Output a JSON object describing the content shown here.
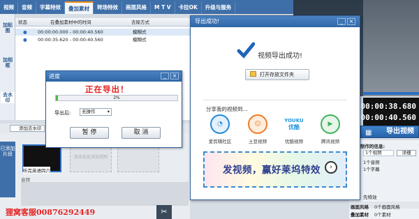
{
  "tabs": [
    "视频",
    "音频",
    "字幕特效",
    "叠加素材",
    "转场特效",
    "画面风格",
    "M T V",
    "卡拉OK",
    "升级与服务"
  ],
  "active_tab": 3,
  "sidebar": {
    "add_sticker": "加贴图",
    "add_frame": "加相框",
    "remove_watermark": "去水印",
    "add_segment": "已添加片段"
  },
  "subtitle_table": {
    "headers": [
      "状态",
      "在叠加素材中的时间",
      "去除方式"
    ],
    "rows": [
      {
        "time": "00:00:00.000 - 00:00:40.560",
        "mode": "模糊式"
      },
      {
        "time": "00:00:35.620 - 00:00:40.560",
        "mode": "模糊式"
      }
    ]
  },
  "progress_dialog": {
    "title": "进度",
    "status_text": "正在导出！",
    "percent": 2,
    "percent_label": "2%",
    "after_export_label": "导出后:",
    "after_export_value": "无操作",
    "pause_label": "暂 停",
    "cancel_label": "取 消"
  },
  "success_dialog": {
    "title": "导出成功!",
    "message": "视频导出成功!",
    "open_folder_label": "打开存放文件夹",
    "share_label": "分享我的视频到...",
    "share_targets": [
      {
        "label": "爱剪辑社区",
        "icon": "aijianji-icon",
        "color": "#1e88d8"
      },
      {
        "label": "土豆视频",
        "icon": "tudou-icon",
        "color": "#f07a23"
      },
      {
        "label": "优酷视频",
        "icon": "youku-icon",
        "color": "#1f95e0"
      },
      {
        "label": "腾讯视频",
        "icon": "tencent-video-icon",
        "color": "#3fb15a"
      }
    ],
    "youku_logo": "YOUKU",
    "youku_logo_sub": "优酷",
    "banner_text": "发视频，赢好莱坞特效"
  },
  "timeline": {
    "add_watermark_label": "添加去水印",
    "clip_name": "听完英语四六",
    "placeholder": "双击此处添加视频",
    "audio_label": "音频"
  },
  "time_display": {
    "total": "00:00:38.680",
    "current": "00:00:40.560"
  },
  "export_button": "导出视频",
  "info_panel": {
    "heading": "制作的信息:",
    "details_button": "详细",
    "lines": [
      "1个视频",
      "1个音频",
      "1个字幕",
      "",
      "先特效",
      "0个画面风格",
      "0个素材"
    ],
    "rows": [
      {
        "k": "画面风格",
        "v": "0个画面风格"
      },
      {
        "k": "叠加素材",
        "v": "0个素材"
      }
    ]
  },
  "watermark": "狸窝客服00876292449"
}
